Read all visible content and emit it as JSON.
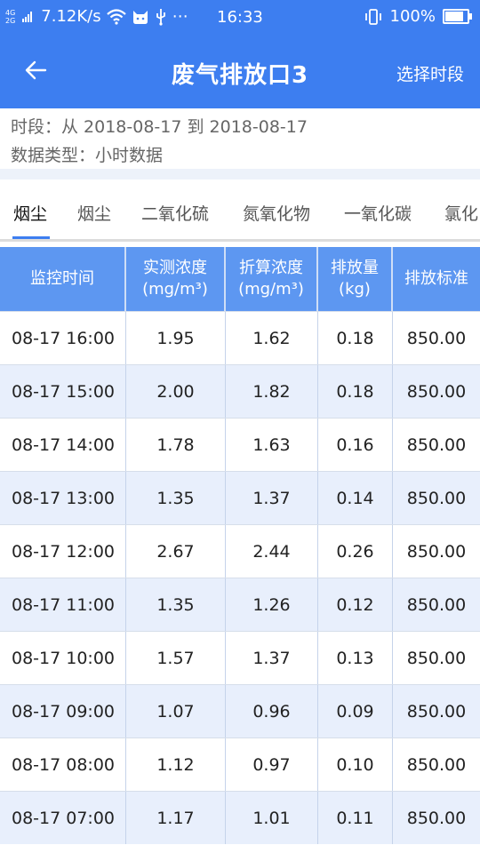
{
  "status_bar": {
    "network_top": "4G",
    "network_bottom": "2G",
    "speed": "7.12K/s",
    "time": "16:33",
    "battery": "100%",
    "battery_level": 1.0
  },
  "header": {
    "back_icon": "arrow-left-icon",
    "title": "废气排放口3",
    "period_button": "选择时段"
  },
  "info": {
    "period": "时段：从 2018-08-17 到 2018-08-17",
    "data_type": "数据类型：小时数据"
  },
  "tabs": [
    "烟尘",
    "烟尘",
    "二氧化硫",
    "氮氧化物",
    "一氧化碳",
    "氯化"
  ],
  "active_tab": 0,
  "table": {
    "headers": [
      {
        "line1": "监控时间",
        "line2": ""
      },
      {
        "line1": "实测浓度",
        "line2": "(mg/m³)"
      },
      {
        "line1": "折算浓度",
        "line2": "(mg/m³)"
      },
      {
        "line1": "排放量",
        "line2": "(kg)"
      },
      {
        "line1": "排放标准",
        "line2": ""
      }
    ],
    "rows": [
      [
        "08-17 16:00",
        "1.95",
        "1.62",
        "0.18",
        "850.00"
      ],
      [
        "08-17 15:00",
        "2.00",
        "1.82",
        "0.18",
        "850.00"
      ],
      [
        "08-17 14:00",
        "1.78",
        "1.63",
        "0.16",
        "850.00"
      ],
      [
        "08-17 13:00",
        "1.35",
        "1.37",
        "0.14",
        "850.00"
      ],
      [
        "08-17 12:00",
        "2.67",
        "2.44",
        "0.26",
        "850.00"
      ],
      [
        "08-17 11:00",
        "1.35",
        "1.26",
        "0.12",
        "850.00"
      ],
      [
        "08-17 10:00",
        "1.57",
        "1.37",
        "0.13",
        "850.00"
      ],
      [
        "08-17 09:00",
        "1.07",
        "0.96",
        "0.09",
        "850.00"
      ],
      [
        "08-17 08:00",
        "1.12",
        "0.97",
        "0.10",
        "850.00"
      ],
      [
        "08-17 07:00",
        "1.17",
        "1.01",
        "0.11",
        "850.00"
      ]
    ]
  },
  "colors": {
    "primary": "#3d7ef0",
    "table_header": "#5d97f1",
    "row_alt": "#e8effc"
  }
}
